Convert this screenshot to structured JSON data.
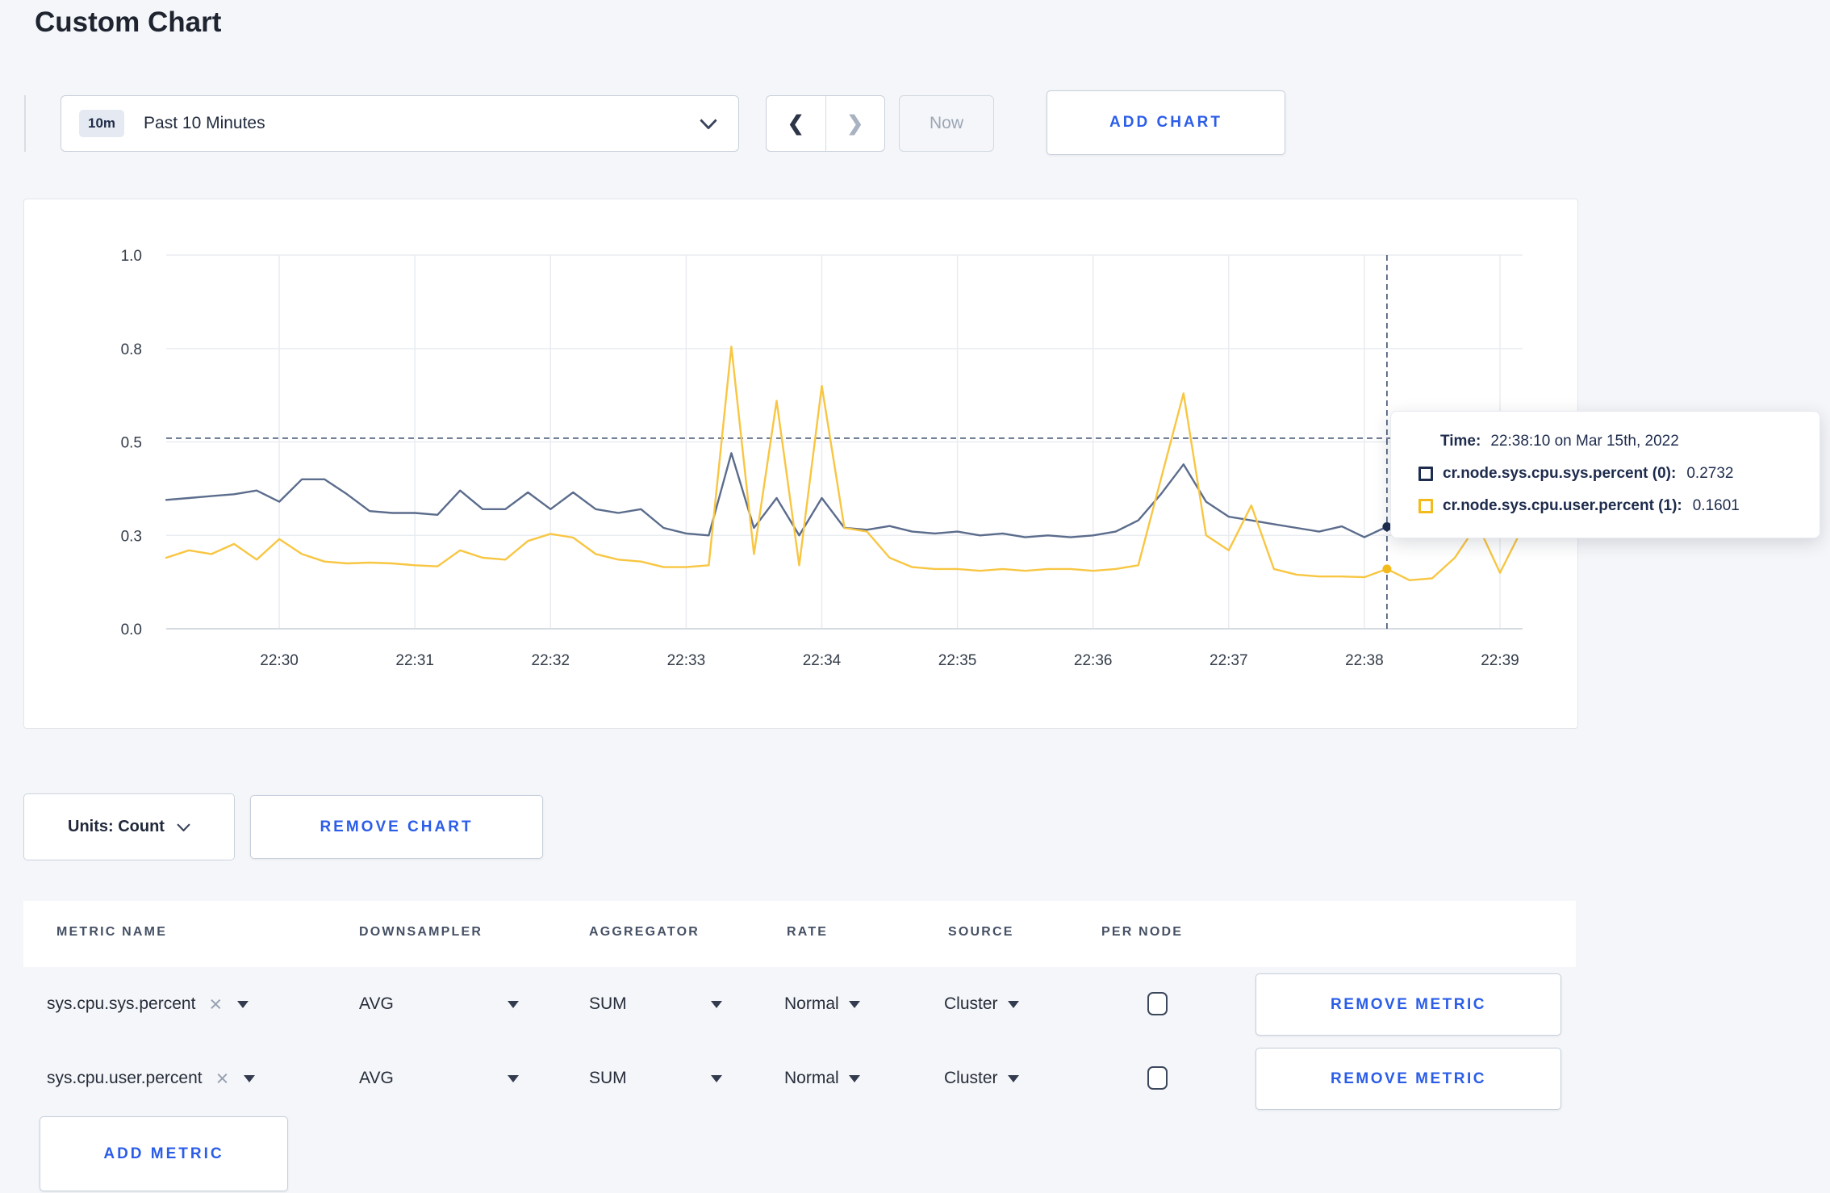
{
  "page": {
    "title": "Custom Chart",
    "background_color": "#f5f6f9",
    "accent_blue": "#2b5de8"
  },
  "toolbar": {
    "time_range": {
      "badge": "10m",
      "label": "Past 10 Minutes"
    },
    "prev_icon": "❮",
    "next_icon": "❯",
    "now_label": "Now",
    "add_chart_label": "ADD CHART"
  },
  "chart_data": {
    "type": "line",
    "title": "",
    "xlabel": "",
    "ylabel": "",
    "ylim": [
      0,
      1
    ],
    "grid": true,
    "x_start_time": "22:29:10",
    "x_interval_seconds": 10,
    "x_ticks": [
      "22:30",
      "22:31",
      "22:32",
      "22:33",
      "22:34",
      "22:35",
      "22:36",
      "22:37",
      "22:38",
      "22:39"
    ],
    "tick_indices": [
      5,
      11,
      17,
      23,
      29,
      35,
      41,
      47,
      53,
      59
    ],
    "y_ticks": [
      {
        "label": "0.0",
        "value": 0
      },
      {
        "label": "0.3",
        "value": 0.25
      },
      {
        "label": "0.5",
        "value": 0.5
      },
      {
        "label": "0.8",
        "value": 0.75
      },
      {
        "label": "1.0",
        "value": 1.0
      }
    ],
    "crosshair": {
      "index": 54,
      "time": "22:38:10",
      "hline_value": 0.51,
      "dash_color": "#53647f"
    },
    "series": [
      {
        "name": "cr.node.sys.cpu.sys.percent",
        "color": "#5b6c8c",
        "swatch_color": "#1e2c4e",
        "values": [
          0.345,
          0.35,
          0.355,
          0.36,
          0.37,
          0.34,
          0.4,
          0.4,
          0.36,
          0.315,
          0.31,
          0.31,
          0.305,
          0.37,
          0.32,
          0.32,
          0.365,
          0.32,
          0.365,
          0.32,
          0.31,
          0.32,
          0.27,
          0.255,
          0.25,
          0.47,
          0.27,
          0.35,
          0.25,
          0.35,
          0.27,
          0.265,
          0.275,
          0.26,
          0.255,
          0.26,
          0.25,
          0.255,
          0.245,
          0.25,
          0.245,
          0.25,
          0.26,
          0.29,
          0.36,
          0.44,
          0.34,
          0.3,
          0.29,
          0.28,
          0.27,
          0.26,
          0.274,
          0.245,
          0.2732,
          0.255,
          0.27,
          0.285,
          0.27,
          0.265,
          0.275
        ]
      },
      {
        "name": "cr.node.sys.cpu.user.percent",
        "color": "#f8c642",
        "swatch_color": "#f3ba1e",
        "values": [
          0.19,
          0.21,
          0.2,
          0.227,
          0.185,
          0.24,
          0.2,
          0.18,
          0.175,
          0.177,
          0.175,
          0.17,
          0.167,
          0.21,
          0.19,
          0.185,
          0.235,
          0.254,
          0.244,
          0.2,
          0.185,
          0.18,
          0.165,
          0.165,
          0.17,
          0.755,
          0.2,
          0.61,
          0.17,
          0.65,
          0.27,
          0.26,
          0.19,
          0.165,
          0.16,
          0.16,
          0.155,
          0.16,
          0.155,
          0.16,
          0.16,
          0.155,
          0.16,
          0.17,
          0.4,
          0.63,
          0.25,
          0.21,
          0.33,
          0.16,
          0.145,
          0.14,
          0.14,
          0.138,
          0.1601,
          0.13,
          0.135,
          0.19,
          0.28,
          0.15,
          0.27
        ]
      }
    ]
  },
  "tooltip": {
    "time_label": "Time:",
    "time_value": "22:38:10 on Mar 15th, 2022",
    "rows": [
      {
        "swatch": "#1e2c4e",
        "label": "cr.node.sys.cpu.sys.percent (0):",
        "value": "0.2732"
      },
      {
        "swatch": "#f3ba1e",
        "label": "cr.node.sys.cpu.user.percent (1):",
        "value": "0.1601"
      }
    ]
  },
  "units": {
    "label": "Units: Count"
  },
  "remove_chart_label": "REMOVE CHART",
  "metrics_table": {
    "headers": [
      "METRIC NAME",
      "DOWNSAMPLER",
      "AGGREGATOR",
      "RATE",
      "SOURCE",
      "PER NODE"
    ],
    "remove_metric_label": "REMOVE METRIC",
    "add_metric_label": "ADD METRIC",
    "rows": [
      {
        "metric": "sys.cpu.sys.percent",
        "downsampler": "AVG",
        "aggregator": "SUM",
        "rate": "Normal",
        "source": "Cluster",
        "per_node": false
      },
      {
        "metric": "sys.cpu.user.percent",
        "downsampler": "AVG",
        "aggregator": "SUM",
        "rate": "Normal",
        "source": "Cluster",
        "per_node": false
      }
    ]
  }
}
